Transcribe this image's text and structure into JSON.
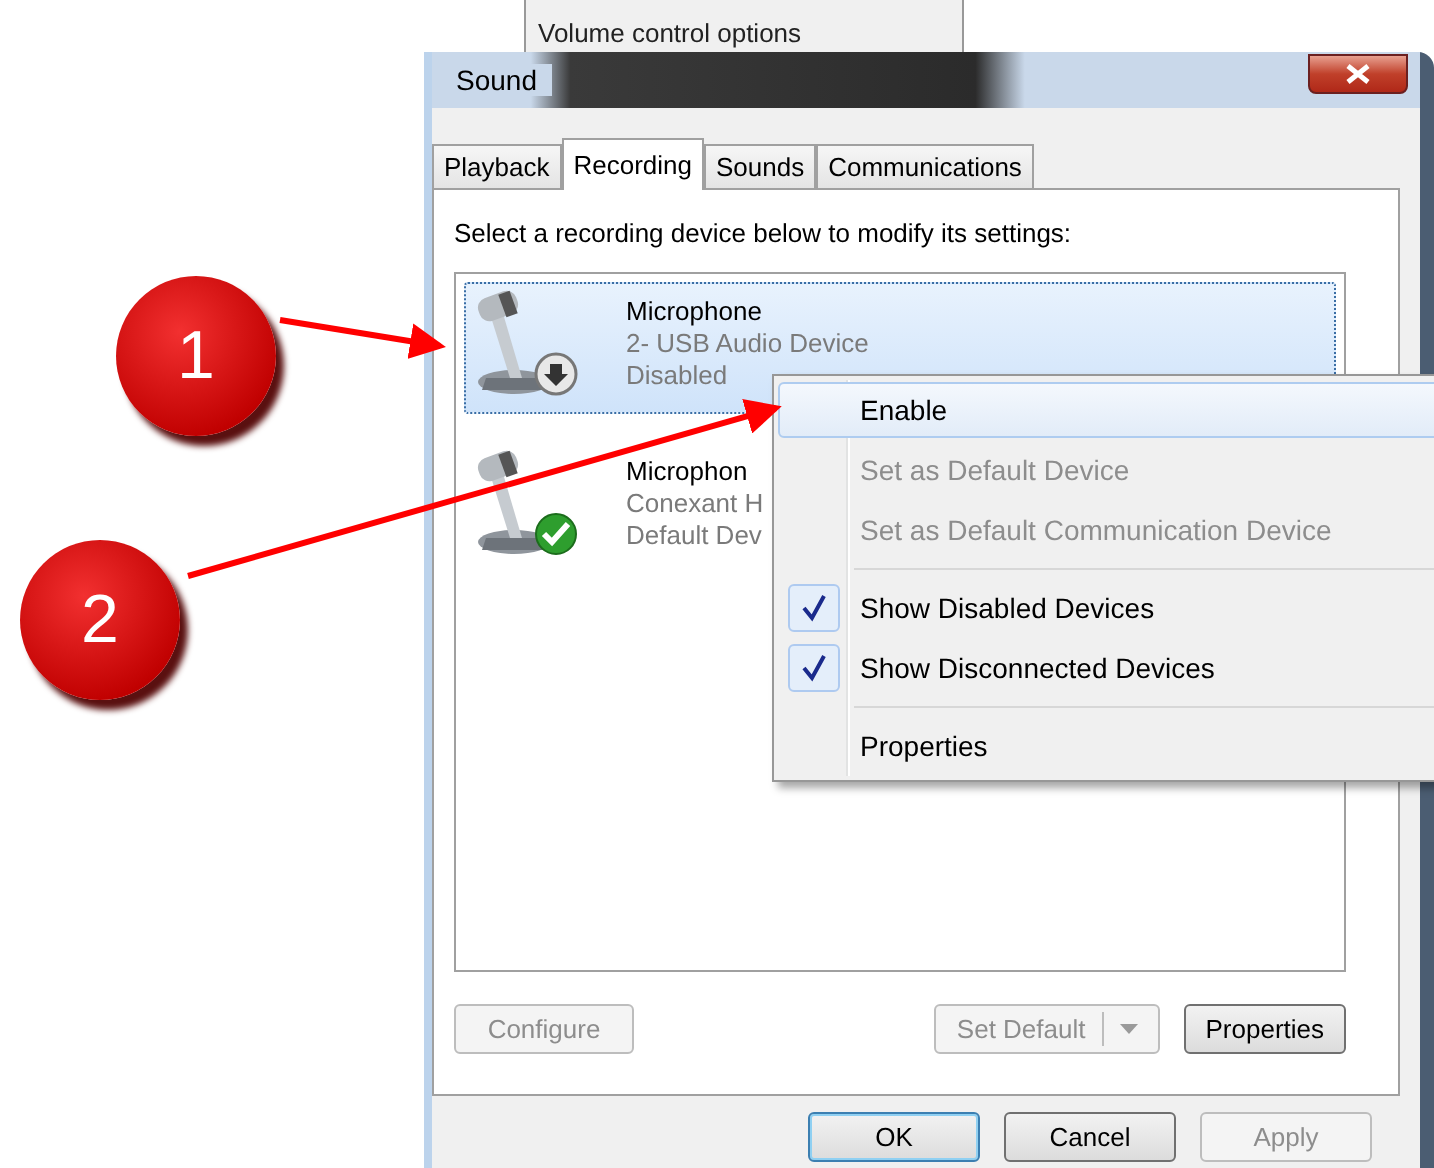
{
  "background_window": {
    "text": "Volume control options"
  },
  "window": {
    "title": "Sound"
  },
  "tabs": [
    {
      "label": "Playback",
      "selected": false
    },
    {
      "label": "Recording",
      "selected": true
    },
    {
      "label": "Sounds",
      "selected": false
    },
    {
      "label": "Communications",
      "selected": false
    }
  ],
  "instruction": "Select a recording device below to modify its settings:",
  "devices": [
    {
      "name": "Microphone",
      "description": "2- USB Audio Device",
      "status": "Disabled",
      "kind": "disabled",
      "selected": true
    },
    {
      "name": "Microphon",
      "description": "Conexant H",
      "status": "Default Dev",
      "kind": "default",
      "selected": false
    }
  ],
  "panel_buttons": [
    {
      "label": "Configure",
      "disabled": true,
      "kind": "plain"
    },
    {
      "label": "Set Default",
      "disabled": true,
      "kind": "split"
    },
    {
      "label": "Properties",
      "disabled": false,
      "kind": "plain"
    }
  ],
  "dialog_buttons": [
    {
      "label": "OK",
      "disabled": false,
      "default": true
    },
    {
      "label": "Cancel",
      "disabled": false,
      "default": false
    },
    {
      "label": "Apply",
      "disabled": true,
      "default": false
    }
  ],
  "context_menu": [
    {
      "kind": "item",
      "label": "Enable",
      "disabled": false,
      "checked": false,
      "highlighted": true
    },
    {
      "kind": "item",
      "label": "Set as Default Device",
      "disabled": true,
      "checked": false,
      "highlighted": false
    },
    {
      "kind": "item",
      "label": "Set as Default Communication Device",
      "disabled": true,
      "checked": false,
      "highlighted": false
    },
    {
      "kind": "separator"
    },
    {
      "kind": "item",
      "label": "Show Disabled Devices",
      "disabled": false,
      "checked": true,
      "highlighted": false
    },
    {
      "kind": "item",
      "label": "Show Disconnected Devices",
      "disabled": false,
      "checked": true,
      "highlighted": false
    },
    {
      "kind": "separator"
    },
    {
      "kind": "item",
      "label": "Properties",
      "disabled": false,
      "checked": false,
      "highlighted": false
    }
  ],
  "annotations": [
    {
      "label": "1"
    },
    {
      "label": "2"
    }
  ]
}
